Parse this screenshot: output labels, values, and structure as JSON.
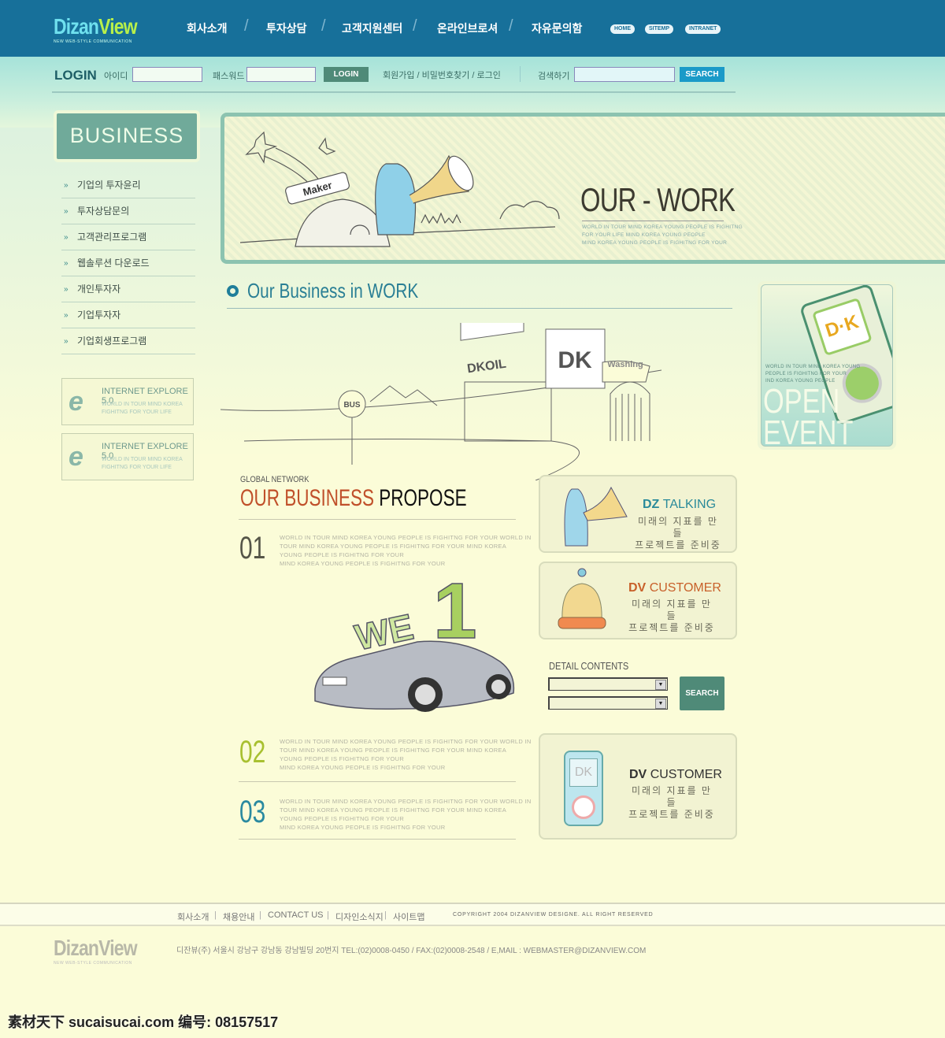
{
  "header": {
    "logo_main": "Dizan",
    "logo_accent": "View",
    "logo_tagline": "NEW WEB-STYLE COMMUNICATION",
    "nav": [
      "회사소개",
      "투자상담",
      "고객지원센터",
      "온라인브로셔",
      "자유문의함"
    ],
    "quick_links": [
      "HOME",
      "SITEMP",
      "INTRANET"
    ]
  },
  "login": {
    "title": "LOGIN",
    "id_label": "아이디",
    "id_value": "",
    "pw_label": "패스워드",
    "pw_value": "",
    "button": "LOGIN",
    "links": "회원가입 / 비밀번호찾기 / 로그인",
    "search_label": "검색하기",
    "search_value": "",
    "search_button": "SEARCH"
  },
  "sidebar": {
    "title": "BUSINESS",
    "items": [
      "기업의 투자윤리",
      "투자상담문의",
      "고객관리프로그램",
      "웹솔루션 다운로드",
      "개인투자자",
      "기업투자자",
      "기업회생프로그램"
    ],
    "promos": [
      {
        "title": "INTERNET EXPLORE 5.0",
        "sub1": "WORLD IN TOUR MIND KOREA",
        "sub2": "FIGHITNG FOR YOUR LIFE"
      },
      {
        "title": "INTERNET EXPLORE 5.0",
        "sub1": "WORLD IN TOUR MIND KOREA",
        "sub2": "FIGHITNG FOR YOUR LIFE"
      }
    ]
  },
  "banner": {
    "badge": "Maker",
    "title": "OUR - WORK",
    "lines": [
      "WORLD IN TOUR MIND KOREA YOUNG PEOPLE IS FIGHITNG",
      "FOR YOUR LIFE MIND KOREA YOUNG PEOPLE",
      "MIND KOREA YOUNG PEOPLE IS FIGHITNG FOR YOUR"
    ]
  },
  "section": {
    "title": "Our Business in WORK",
    "signs": {
      "bus": "BUS",
      "dkoil": "DKOIL",
      "dk": "DK",
      "washing": "Washing"
    }
  },
  "event": {
    "logo": "D·K",
    "lines": [
      "WORLD IN TOUR MIND KOREA YOUNG",
      "PEOPLE IS FIGHITNG FOR YOUR",
      "IND KOREA YOUNG PEOPLE"
    ],
    "title1": "OPEN",
    "title2": "EVENT"
  },
  "propose": {
    "kicker": "GLOBAL NETWORK",
    "title_accent": "OUR BUSINESS",
    "title_rest": "PROPOSE",
    "we": "WE",
    "one": "1",
    "items": [
      {
        "num": "01",
        "color": "#555548",
        "lines": [
          "WORLD IN TOUR MIND KOREA YOUNG PEOPLE IS FIGHITNG FOR YOUR WORLD IN",
          "TOUR MIND KOREA YOUNG  PEOPLE IS FIGHITNG FOR YOUR MIND KOREA",
          "YOUNG PEOPLE IS FIGHITNG FOR YOUR",
          "MIND KOREA YOUNG PEOPLE IS FIGHITNG FOR YOUR"
        ]
      },
      {
        "num": "02",
        "color": "#a8c030",
        "lines": [
          "WORLD IN TOUR MIND KOREA YOUNG PEOPLE IS FIGHITNG FOR YOUR WORLD IN",
          "TOUR MIND KOREA YOUNG  PEOPLE IS FIGHITNG FOR YOUR MIND KOREA",
          "YOUNG PEOPLE IS FIGHITNG FOR YOUR",
          "MIND KOREA YOUNG PEOPLE IS FIGHITNG FOR YOUR"
        ]
      },
      {
        "num": "03",
        "color": "#2a8aa0",
        "lines": [
          "WORLD IN TOUR MIND KOREA YOUNG PEOPLE IS FIGHITNG FOR YOUR WORLD IN",
          "TOUR MIND KOREA YOUNG  PEOPLE IS FIGHITNG FOR YOUR MIND KOREA",
          "YOUNG PEOPLE IS FIGHITNG FOR YOUR",
          "MIND KOREA YOUNG PEOPLE IS FIGHITNG FOR YOUR"
        ]
      }
    ]
  },
  "cards": [
    {
      "a": "DZ",
      "b": "TALKING",
      "color": "#2a8a9a",
      "l1": "미래의 지표를 만들",
      "l2": "프로젝트를 준비중"
    },
    {
      "a": "DV",
      "b": "CUSTOMER",
      "color": "#c8602a",
      "l1": "미래의 지표를 만들",
      "l2": "프로젝트를 준비중"
    },
    {
      "a": "DV",
      "b": "CUSTOMER",
      "color": "#333",
      "l1": "미래의 지표를 만들",
      "l2": "프로젝트를 준비중",
      "icon_text": "DK"
    }
  ],
  "detail": {
    "label": "DETAIL CONTENTS",
    "select1": "",
    "select2": "",
    "button": "SEARCH"
  },
  "footer": {
    "links": [
      "회사소개",
      "채용안내",
      "CONTACT US",
      "디자인소식지",
      "사이트맵"
    ],
    "copyright": "COPYRIGHT 2004 DIZANVIEW DESIGNE. ALL RIGHT RESERVED",
    "address": "디잔뷰(주) 서울시 강남구 강남동 강남빌딩 20번지  TEL:(02)0008-0450 / FAX:(02)0008-2548 / E,MAIL : WEBMASTER@DIZANVIEW.COM",
    "logo": "DizanView",
    "logo_tagline": "NEW WEB-STYLE COMMUNICATION"
  },
  "watermark": "素材天下 sucaisucai.com  编号: 08157517",
  "colors": {
    "header": "#17709a",
    "accent": "#2a7f95",
    "button_dark": "#4f8a78",
    "button_blue": "#1a9ac8",
    "background": "#fbfcd8"
  }
}
